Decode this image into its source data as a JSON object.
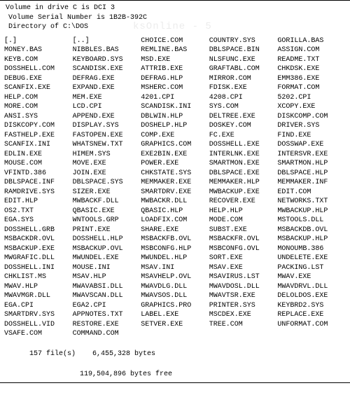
{
  "header": {
    "line1": "Volume in drive C is DCI 3",
    "line2": "Volume Serial Number is 1B2B-392C",
    "line3": "Directory of C:\\DOS"
  },
  "columns": [
    [
      "[.]",
      "MONEY.BAS",
      "KEYB.COM",
      "DOSSHELL.COM",
      "DEBUG.EXE",
      "SCANFIX.EXE",
      "HELP.COM",
      "MORE.COM",
      "ANSI.SYS",
      "DISKCOPY.COM",
      "FASTHELP.EXE",
      "SCANFIX.INI",
      "EDLIN.EXE",
      "MOUSE.COM",
      "VFINTD.386",
      "DBLSPACE.INF",
      "RAMDRIVE.SYS",
      "EDIT.HLP",
      "OS2.TXT",
      "EGA.SYS",
      "DOSSHELL.GRB",
      "MSBACKDR.OVL",
      "MSBACKUP.EXE",
      "MWGRAFIC.DLL",
      "DOSSHELL.INI",
      "CHKLIST.MS",
      "MWAV.HLP",
      "MWAVMGR.DLL",
      "EGA.CPI",
      "SMARTDRV.SYS",
      "DOSSHELL.VID",
      "VSAFE.COM"
    ],
    [
      "[..]",
      "NIBBLES.BAS",
      "KEYBOARD.SYS",
      "SCANDISK.EXE",
      "DEFRAG.EXE",
      "EXPAND.EXE",
      "MEM.EXE",
      "LCD.CPI",
      "APPEND.EXE",
      "DISPLAY.SYS",
      "FASTOPEN.EXE",
      "WHATSNEW.TXT",
      "HIMEM.SYS",
      "MOVE.EXE",
      "JOIN.EXE",
      "DBLSPACE.SYS",
      "SIZER.EXE",
      "MWBACKF.DLL",
      "QBASIC.EXE",
      "WNTOOLS.GRP",
      "PRINT.EXE",
      "DOSSHELL.HLP",
      "MSBACKUP.OVL",
      "MWUNDEL.EXE",
      "MOUSE.INI",
      "MSAV.HLP",
      "MWAVABSI.DLL",
      "MWAVSCAN.DLL",
      "EGA2.CPI",
      "APPNOTES.TXT",
      "RESTORE.EXE",
      "COMMAND.COM"
    ],
    [
      "CHOICE.COM",
      "REMLINE.BAS",
      "MSD.EXE",
      "ATTRIB.EXE",
      "DEFRAG.HLP",
      "MSHERC.COM",
      "4201.CPI",
      "SCANDISK.INI",
      "DBLWIN.HLP",
      "DOSHELP.HLP",
      "COMP.EXE",
      "GRAPHICS.COM",
      "EXE2BIN.EXE",
      "POWER.EXE",
      "CHKSTATE.SYS",
      "MEMMAKER.EXE",
      "SMARTDRV.EXE",
      "MWBACKR.DLL",
      "QBASIC.HLP",
      "LOADFIX.COM",
      "SHARE.EXE",
      "MSBACKFB.OVL",
      "MSBCONFG.HLP",
      "MWUNDEL.HLP",
      "MSAV.INI",
      "MSAVHELP.OVL",
      "MWAVDLG.DLL",
      "MWAVSOS.DLL",
      "GRAPHICS.PRO",
      "LABEL.EXE",
      "SETVER.EXE",
      ""
    ],
    [
      "COUNTRY.SYS",
      "DBLSPACE.BIN",
      "NLSFUNC.EXE",
      "GRAFTABL.COM",
      "MIRROR.COM",
      "FDISK.EXE",
      "4208.CPI",
      "SYS.COM",
      "DELTREE.EXE",
      "DOSKEY.COM",
      "FC.EXE",
      "DOSSHELL.EXE",
      "INTERLNK.EXE",
      "SMARTMON.EXE",
      "DBLSPACE.EXE",
      "MEMMAKER.HLP",
      "MWBACKUP.EXE",
      "RECOVER.EXE",
      "HELP.HLP",
      "MODE.COM",
      "SUBST.EXE",
      "MSBACKFR.OVL",
      "MSBCONFG.OVL",
      "SORT.EXE",
      "MSAV.EXE",
      "MSAVIRUS.LST",
      "MWAVDOSL.DLL",
      "MWAVTSR.EXE",
      "PRINTER.SYS",
      "MSCDEX.EXE",
      "TREE.COM",
      ""
    ],
    [
      "GORILLA.BAS",
      "ASSIGN.COM",
      "README.TXT",
      "CHKDSK.EXE",
      "EMM386.EXE",
      "FORMAT.COM",
      "5202.CPI",
      "XCOPY.EXE",
      "DISKCOMP.COM",
      "DRIVER.SYS",
      "FIND.EXE",
      "DOSSWAP.EXE",
      "INTERSVR.EXE",
      "SMARTMON.HLP",
      "DBLSPACE.HLP",
      "MEMMAKER.INF",
      "EDIT.COM",
      "NETWORKS.TXT",
      "MWBACKUP.HLP",
      "MSTOOLS.DLL",
      "MSBACKDB.OVL",
      "MSBACKUP.HLP",
      "MONOUMB.386",
      "UNDELETE.EXE",
      "PACKING.LST",
      "MWAV.EXE",
      "MWAVDRVL.DLL",
      "DELOLDOS.EXE",
      "KEYBRD2.SYS",
      "REPLACE.EXE",
      "UNFORMAT.COM",
      ""
    ]
  ],
  "footer": {
    "files_label": "157 file(s)",
    "bytes": "6,455,328 bytes",
    "free": "119,504,896 bytes free"
  },
  "watermark": "ksOnline - 5"
}
